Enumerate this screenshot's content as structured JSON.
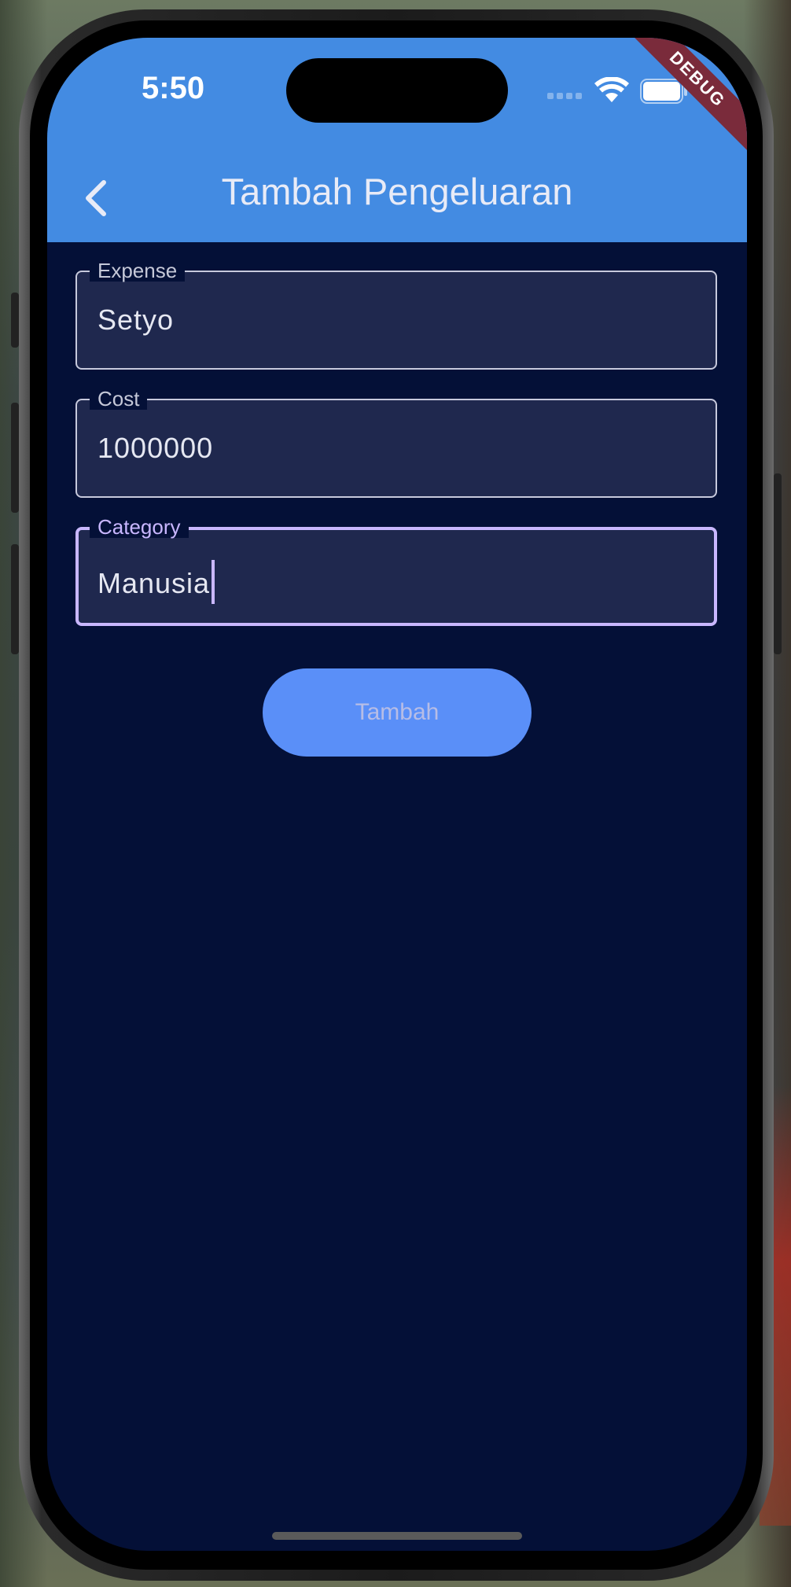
{
  "status_bar": {
    "time": "5:50"
  },
  "debug_banner": "DEBUG",
  "app_bar": {
    "title": "Tambah Pengeluaran",
    "background_color": "#438be2"
  },
  "form": {
    "fields": [
      {
        "label": "Expense",
        "value": "Setyo",
        "focused": false
      },
      {
        "label": "Cost",
        "value": "1000000",
        "focused": false
      },
      {
        "label": "Category",
        "value": "Manusia",
        "focused": true
      }
    ],
    "submit_label": "Tambah"
  },
  "colors": {
    "background": "#041037",
    "field_fill": "#1f284e",
    "focus_accent": "#c9b7ff",
    "button": "#5a8ff8"
  },
  "icons": {
    "back": "back-arrow-icon",
    "wifi": "wifi-icon",
    "battery": "battery-icon"
  }
}
